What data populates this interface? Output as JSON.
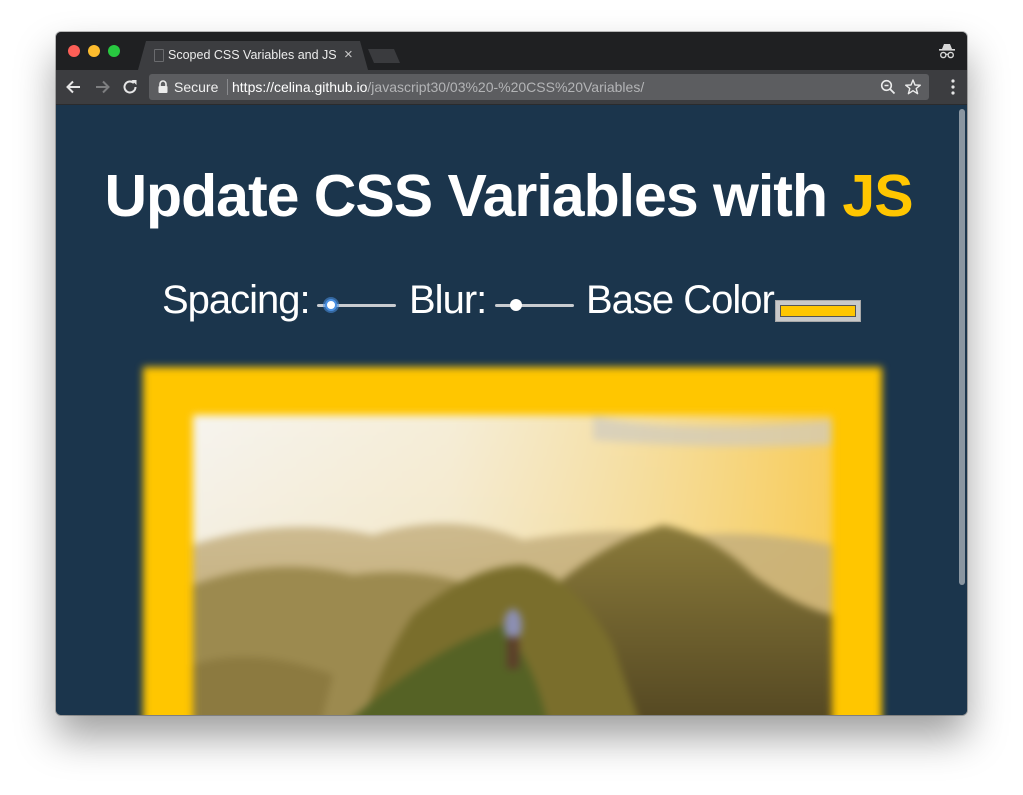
{
  "browser": {
    "tab_title": "Scoped CSS Variables and JS",
    "tab_close": "×",
    "address": {
      "security_label": "Secure",
      "url_host": "https://celina.github.io",
      "url_path": "/javascript30/03%20-%20CSS%20Variables/"
    },
    "icons": [
      "back-icon",
      "forward-icon",
      "reload-icon",
      "lock-icon",
      "zoom-icon",
      "star-icon",
      "menu-icon",
      "incognito-icon"
    ]
  },
  "page": {
    "heading_main": "Update CSS Variables with ",
    "heading_accent": "JS",
    "controls": {
      "spacing_label": "Spacing:",
      "spacing_value": 0.12,
      "blur_label": "Blur:",
      "blur_value": 0.22,
      "base_color_label": "Base Color",
      "base_color_value": "#ffc600"
    },
    "colors": {
      "background": "#1b354c",
      "accent": "#ffc600",
      "text": "#ffffff"
    }
  }
}
